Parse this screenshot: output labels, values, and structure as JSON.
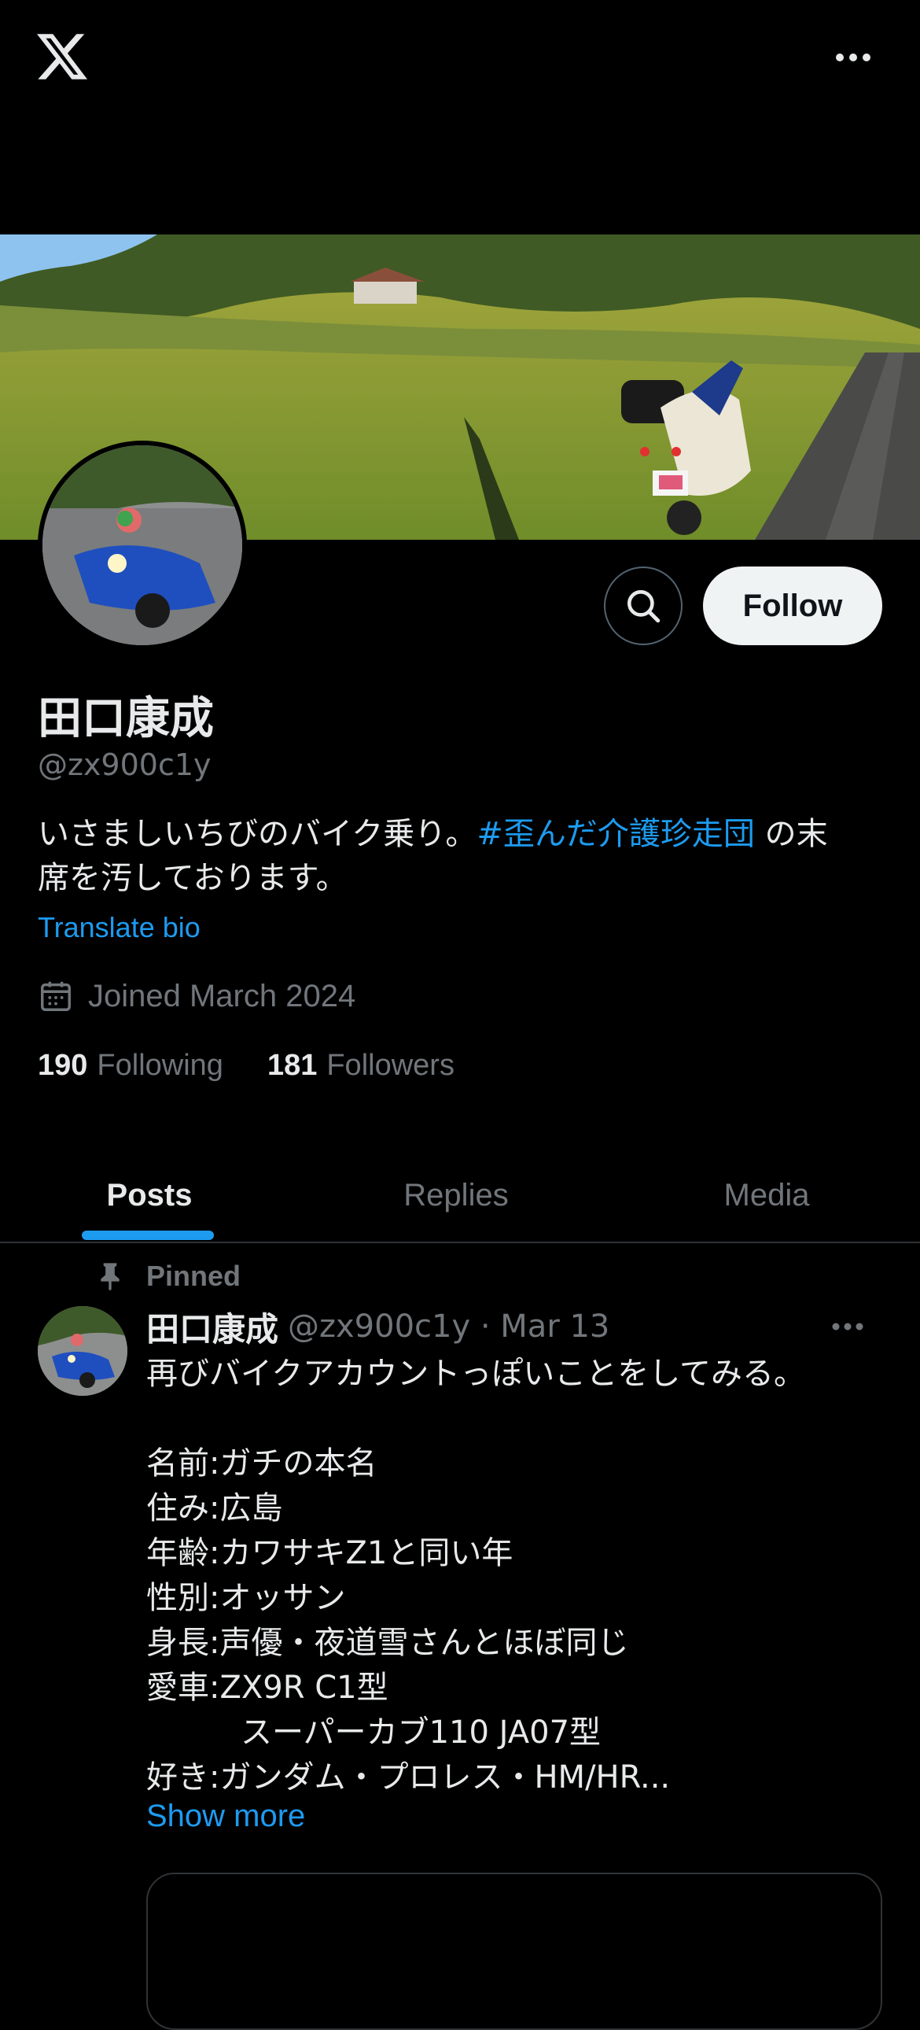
{
  "topbar": {
    "logo_icon": "x-logo-icon",
    "more_icon": "more-horizontal-icon"
  },
  "profile": {
    "name": "田口康成",
    "handle": "@zx900c1y",
    "bio_text": "いさましいちびのバイク乗り。",
    "bio_hashtag": "#歪んだ介護珍走団",
    "bio_rest_line1": " の末",
    "bio_line2": "席を汚しております。",
    "translate_label": "Translate bio",
    "joined": "Joined March 2024",
    "following_count": "190",
    "following_label": "Following",
    "followers_count": "181",
    "followers_label": "Followers"
  },
  "actions": {
    "follow_label": "Follow",
    "search_icon": "search-icon"
  },
  "tabs": [
    {
      "label": "Posts",
      "active": true
    },
    {
      "label": "Replies",
      "active": false
    },
    {
      "label": "Media",
      "active": false
    }
  ],
  "post": {
    "pinned_label": "Pinned",
    "author_name": "田口康成",
    "meta": "@zx900c1y · Mar 13",
    "body": "再びバイクアカウントっぽいことをしてみる。\n\n名前:ガチの本名\n住み:広島\n年齢:カワサキZ1と同い年\n性別:オッサン\n身長:声優・夜道雪さんとほぼ同じ\n愛車:ZX9R C1型\n　　　スーパーカブ110 JA07型\n好き:ガンダム・プロレス・HM/HR...",
    "show_more": "Show more"
  },
  "colors": {
    "accent": "#1d9bf0",
    "background": "#000000",
    "text": "#e7e9ea",
    "muted": "#71767b",
    "follow_bg": "#eff3f4"
  }
}
